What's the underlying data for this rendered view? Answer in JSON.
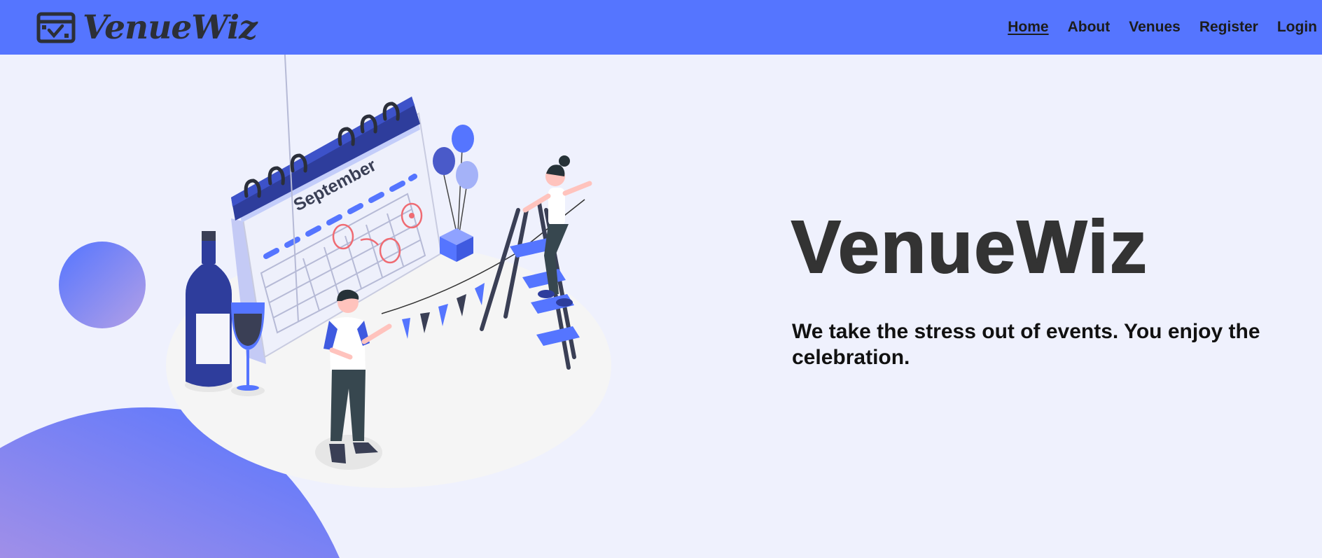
{
  "brand": {
    "name": "VenueWiz",
    "logo_icon": "calendar-check-icon"
  },
  "nav": {
    "items": [
      {
        "label": "Home",
        "active": true
      },
      {
        "label": "About",
        "active": false
      },
      {
        "label": "Venues",
        "active": false
      },
      {
        "label": "Register",
        "active": false
      },
      {
        "label": "Login",
        "active": false
      }
    ]
  },
  "hero": {
    "title": "VenueWiz",
    "tagline": "We take the stress out of events. You enjoy the celebration."
  },
  "illustration": {
    "calendar_month": "September"
  },
  "colors": {
    "navbar": "#5575ff",
    "background": "#eff1fd",
    "accent_dark": "#2e3d9c",
    "title_text": "#333333"
  }
}
